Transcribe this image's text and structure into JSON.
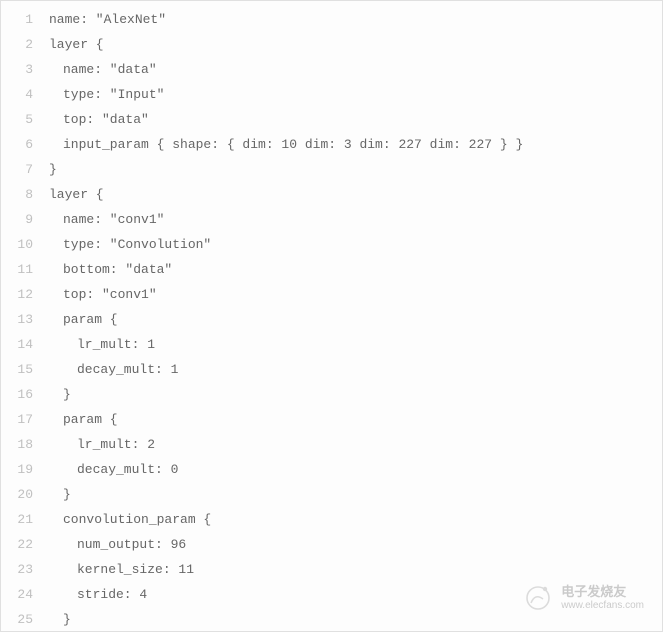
{
  "code": {
    "lines": [
      {
        "num": "1",
        "indent": 0,
        "text": "name: \"AlexNet\""
      },
      {
        "num": "2",
        "indent": 0,
        "text": "layer {"
      },
      {
        "num": "3",
        "indent": 1,
        "text": "name: \"data\""
      },
      {
        "num": "4",
        "indent": 1,
        "text": "type: \"Input\""
      },
      {
        "num": "5",
        "indent": 1,
        "text": "top: \"data\""
      },
      {
        "num": "6",
        "indent": 1,
        "text": "input_param { shape: { dim: 10 dim: 3 dim: 227 dim: 227 } }"
      },
      {
        "num": "7",
        "indent": 0,
        "text": "}"
      },
      {
        "num": "8",
        "indent": 0,
        "text": "layer {"
      },
      {
        "num": "9",
        "indent": 1,
        "text": "name: \"conv1\""
      },
      {
        "num": "10",
        "indent": 1,
        "text": "type: \"Convolution\""
      },
      {
        "num": "11",
        "indent": 1,
        "text": "bottom: \"data\""
      },
      {
        "num": "12",
        "indent": 1,
        "text": "top: \"conv1\""
      },
      {
        "num": "13",
        "indent": 1,
        "text": "param {"
      },
      {
        "num": "14",
        "indent": 2,
        "text": "lr_mult: 1"
      },
      {
        "num": "15",
        "indent": 2,
        "text": "decay_mult: 1"
      },
      {
        "num": "16",
        "indent": 1,
        "text": "}"
      },
      {
        "num": "17",
        "indent": 1,
        "text": "param {"
      },
      {
        "num": "18",
        "indent": 2,
        "text": "lr_mult: 2"
      },
      {
        "num": "19",
        "indent": 2,
        "text": "decay_mult: 0"
      },
      {
        "num": "20",
        "indent": 1,
        "text": "}"
      },
      {
        "num": "21",
        "indent": 1,
        "text": "convolution_param {"
      },
      {
        "num": "22",
        "indent": 2,
        "text": "num_output: 96"
      },
      {
        "num": "23",
        "indent": 2,
        "text": "kernel_size: 11"
      },
      {
        "num": "24",
        "indent": 2,
        "text": "stride: 4"
      },
      {
        "num": "25",
        "indent": 1,
        "text": "}"
      }
    ]
  },
  "watermark": {
    "cn": "电子发烧友",
    "url": "www.elecfans.com"
  }
}
